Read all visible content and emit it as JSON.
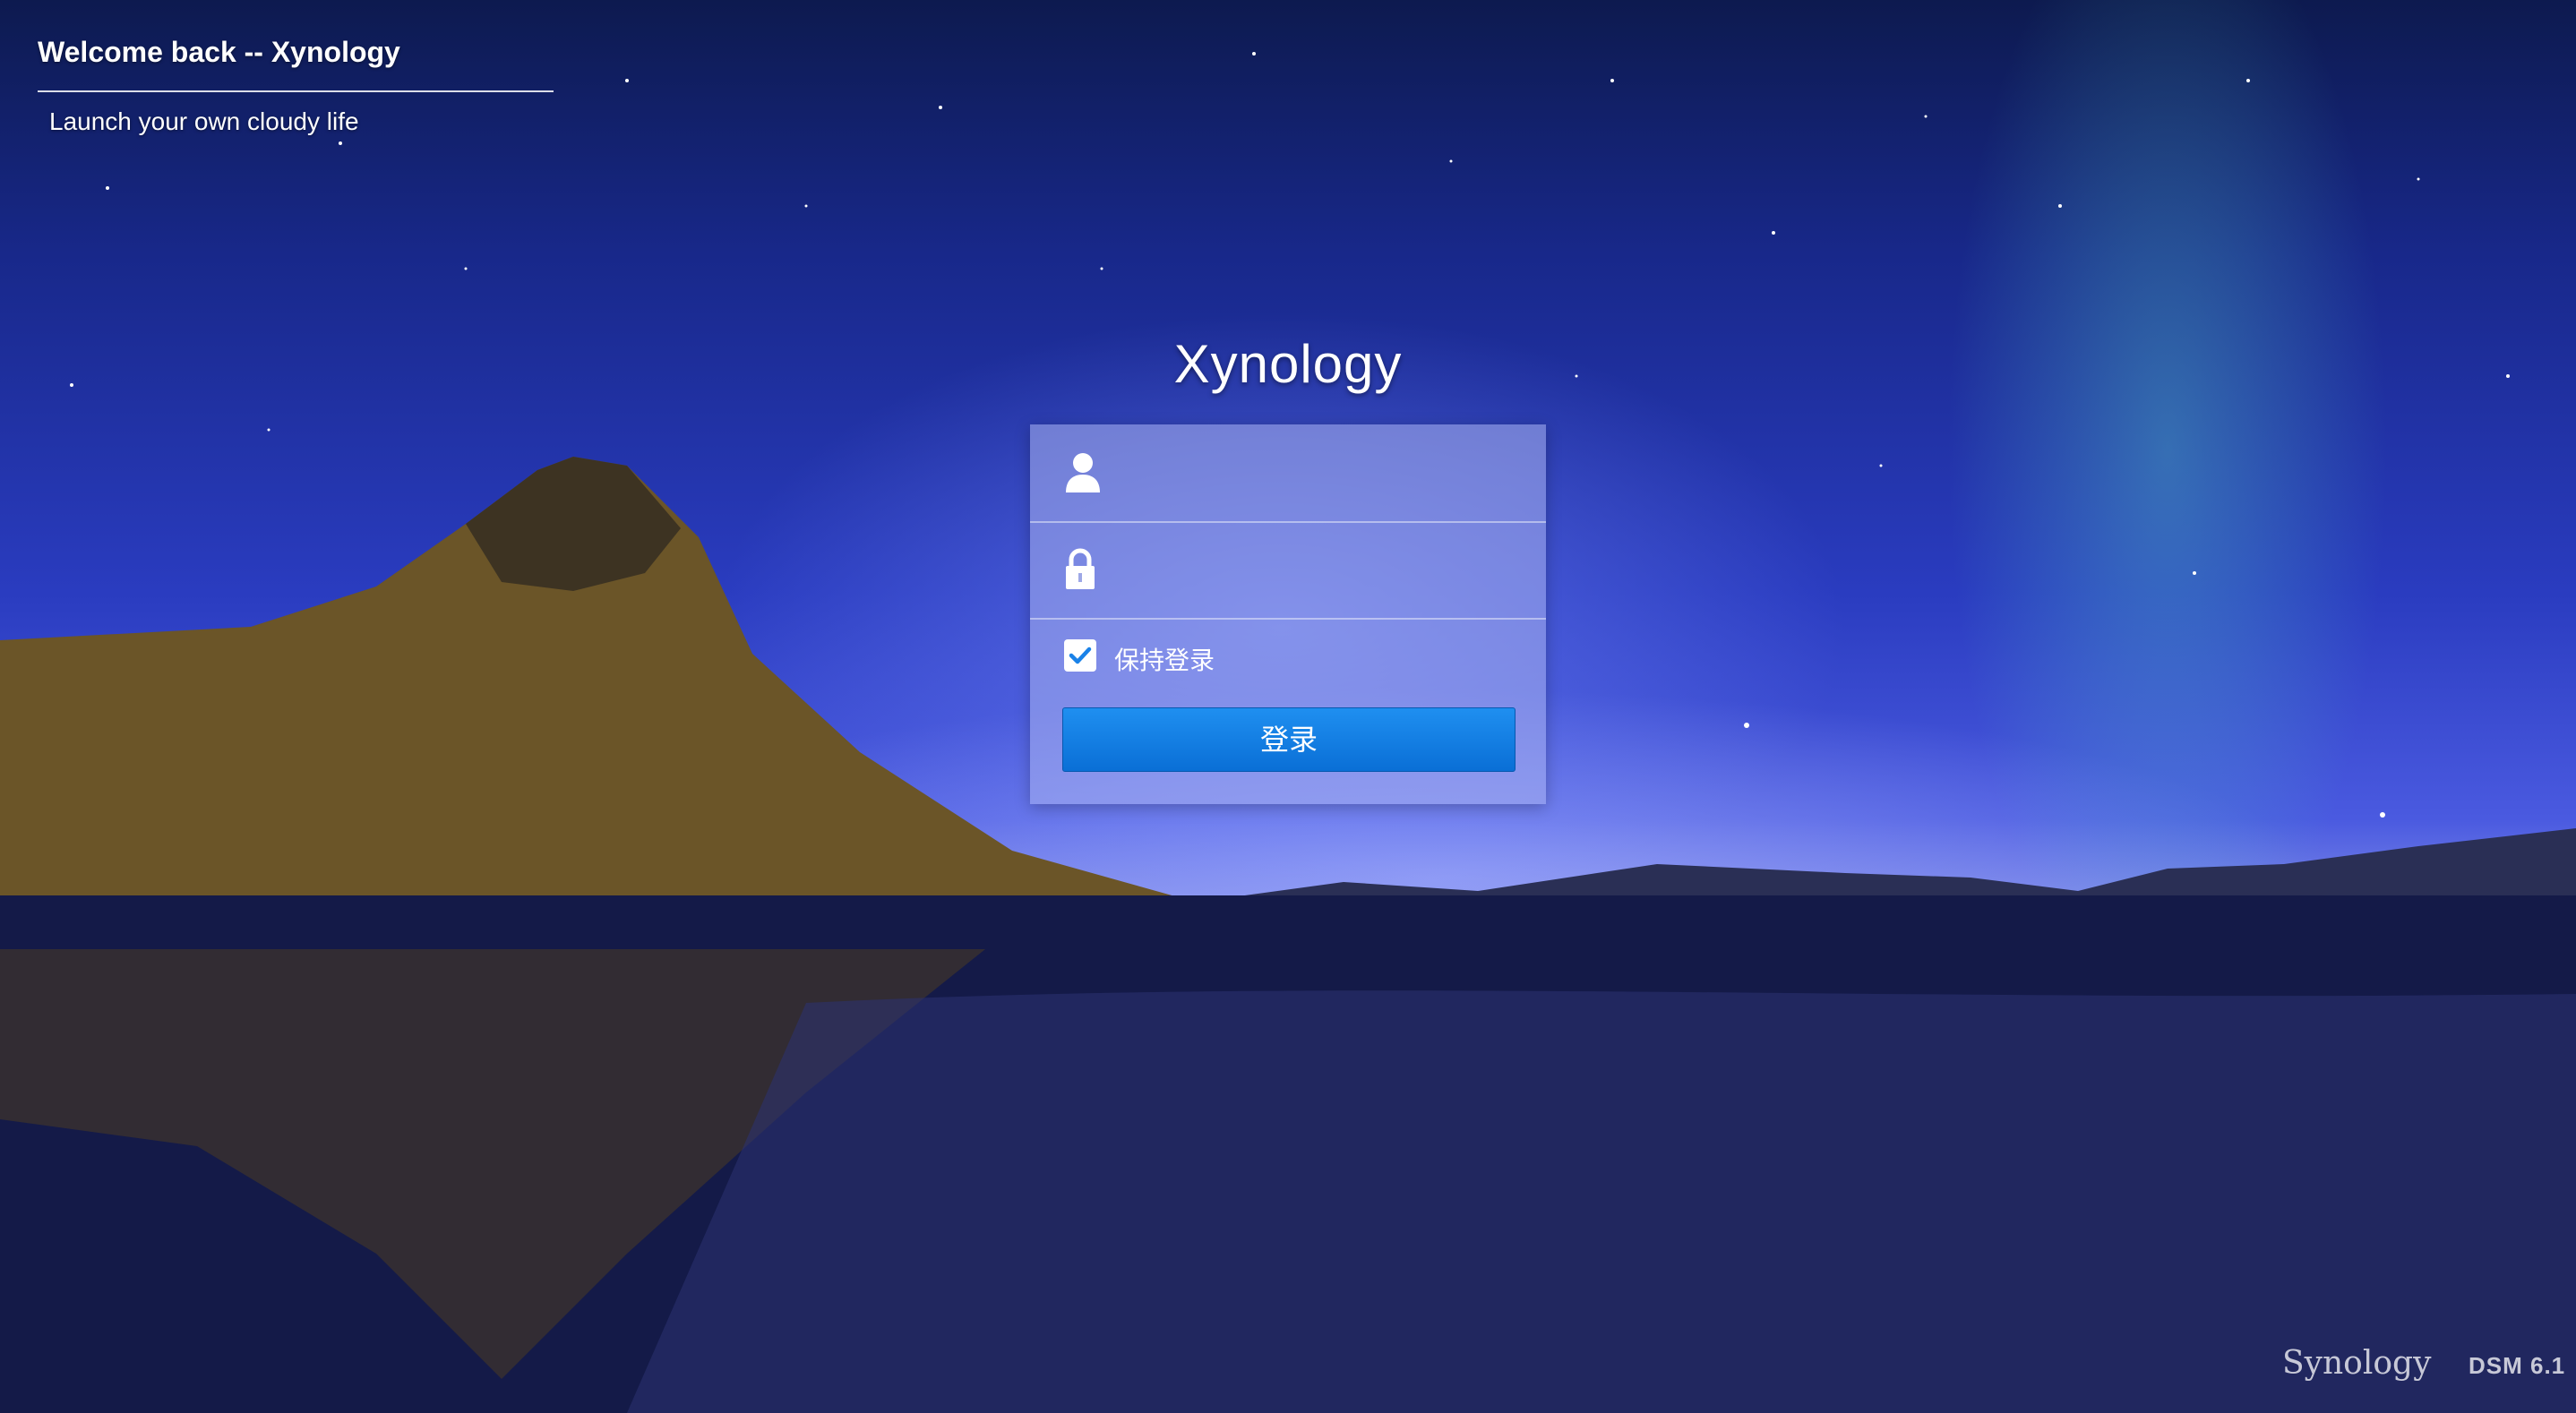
{
  "header": {
    "welcome_title": "Welcome back -- Xynology",
    "welcome_subtitle": "Launch your own cloudy life"
  },
  "login": {
    "brand_title": "Xynology",
    "username_placeholder": "",
    "password_placeholder": "",
    "remember_label": "保持登录",
    "remember_checked": true,
    "submit_label": "登录",
    "button_color": "#1a82e8"
  },
  "footer": {
    "logo": "Synology",
    "version": "DSM 6.1"
  },
  "icons": [
    "user-icon",
    "lock-icon",
    "checkmark-icon"
  ]
}
